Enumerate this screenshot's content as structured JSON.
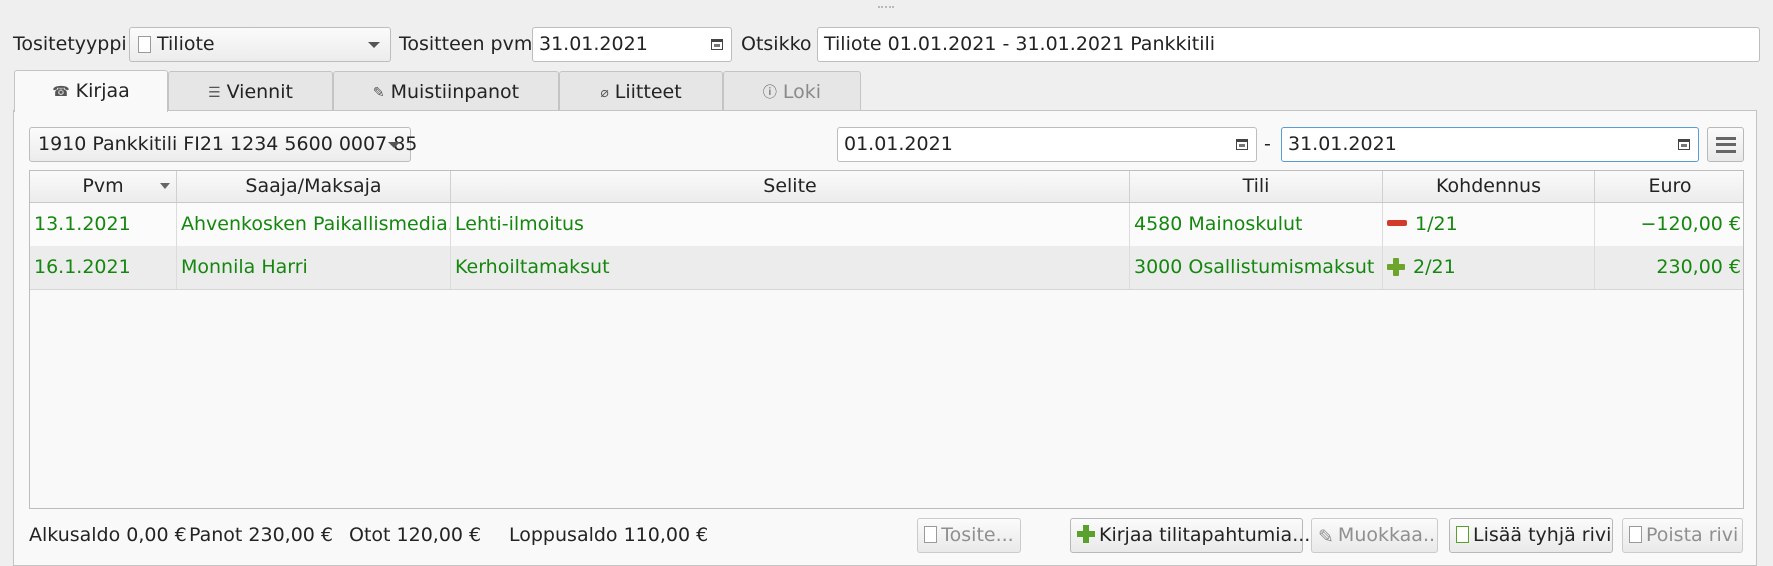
{
  "header": {
    "tositetyyppi_label": "Tositetyyppi",
    "tositetyyppi_value": "Tiliote",
    "pvm_label": "Tositteen pvm",
    "pvm_value": "31.01.2021",
    "otsikko_label": "Otsikko",
    "otsikko_value": "Tiliote 01.01.2021 - 31.01.2021 Pankkitili"
  },
  "tabs": [
    {
      "label": "Kirjaa",
      "icon": "phone-icon",
      "active": true
    },
    {
      "label": "Viennit",
      "icon": "list-icon"
    },
    {
      "label": "Muistiinpanot",
      "icon": "note-icon"
    },
    {
      "label": "Liitteet",
      "icon": "paperclip-icon"
    },
    {
      "label": "Loki",
      "icon": "info-icon",
      "disabled": true
    }
  ],
  "filter": {
    "account": "1910 Pankkitili FI21 1234 5600 0007 85",
    "date_from": "01.01.2021",
    "date_sep": "-",
    "date_to": "31.01.2021"
  },
  "table": {
    "columns": [
      "Pvm",
      "Saaja/Maksaja",
      "Selite",
      "Tili",
      "Kohdennus",
      "Euro"
    ],
    "rows": [
      {
        "pvm": "13.1.2021",
        "saaja": "Ahvenkosken Paikallismedia...",
        "selite": "Lehti-ilmoitus",
        "tili": "4580 Mainoskulut",
        "kohdennus": "1/21",
        "kohdennus_icon": "minus-icon",
        "euro": "−120,00 €"
      },
      {
        "pvm": "16.1.2021",
        "saaja": "Monnila Harri",
        "selite": "Kerhoiltamaksut",
        "tili": "3000 Osallistumismaksut",
        "kohdennus": "2/21",
        "kohdennus_icon": "plus-icon",
        "euro": "230,00 €"
      }
    ]
  },
  "footer": {
    "alkusaldo": "Alkusaldo 0,00 €",
    "panot": "Panot 230,00 €",
    "otot": "Otot 120,00 €",
    "loppusaldo": "Loppusaldo 110,00 €"
  },
  "buttons": {
    "tosite": "Tosite...",
    "kirjaa": "Kirjaa tilitapahtumia...",
    "muokkaa": "Muokkaa..",
    "lisaa": "Lisää tyhjä rivi",
    "poista": "Poista rivi"
  },
  "colors": {
    "income_text": "#15870f",
    "minus_badge": "#d23a2a",
    "plus_badge": "#6da52c"
  }
}
